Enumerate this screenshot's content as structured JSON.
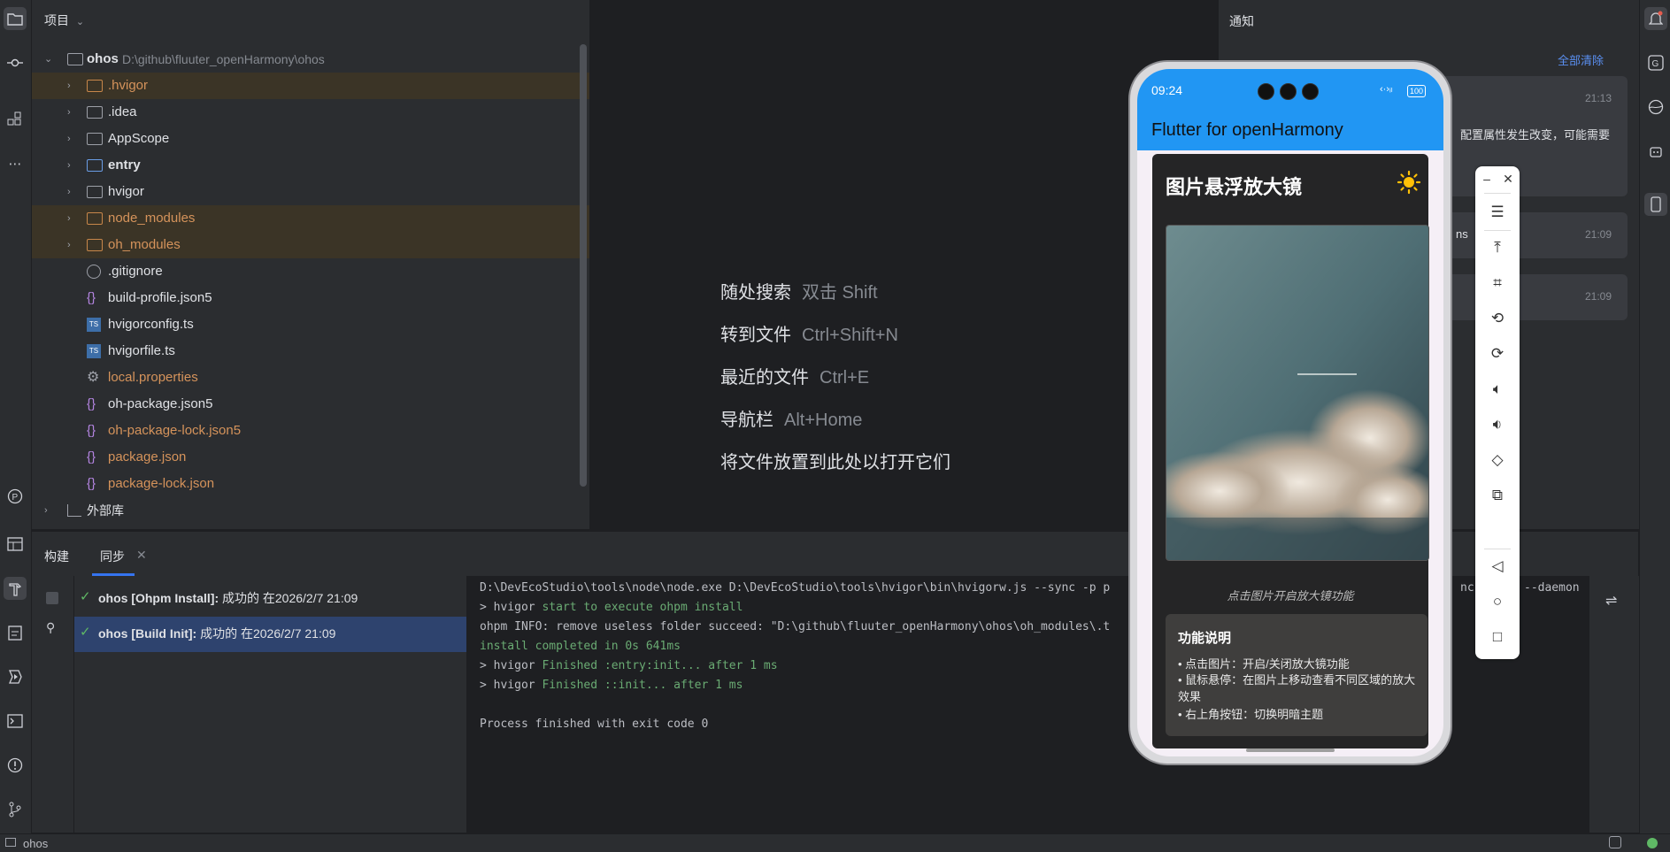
{
  "project": {
    "header": "项目",
    "root_name": "ohos",
    "root_path": "D:\\github\\fluuter_openHarmony\\ohos",
    "items": [
      {
        "label": ".hvigor",
        "kind": "folder",
        "excluded": true
      },
      {
        "label": ".idea",
        "kind": "folder",
        "excluded": false
      },
      {
        "label": "AppScope",
        "kind": "folder",
        "excluded": false
      },
      {
        "label": "entry",
        "kind": "module",
        "excluded": false
      },
      {
        "label": "hvigor",
        "kind": "folder",
        "excluded": false
      },
      {
        "label": "node_modules",
        "kind": "folder",
        "excluded": true
      },
      {
        "label": "oh_modules",
        "kind": "folder",
        "excluded": true
      },
      {
        "label": ".gitignore",
        "kind": "ignore"
      },
      {
        "label": "build-profile.json5",
        "kind": "json"
      },
      {
        "label": "hvigorconfig.ts",
        "kind": "ts"
      },
      {
        "label": "hvigorfile.ts",
        "kind": "ts"
      },
      {
        "label": "local.properties",
        "kind": "settings"
      },
      {
        "label": "oh-package.json5",
        "kind": "json"
      },
      {
        "label": "oh-package-lock.json5",
        "kind": "json"
      },
      {
        "label": "package.json",
        "kind": "json"
      },
      {
        "label": "package-lock.json",
        "kind": "json"
      }
    ],
    "external": "外部库"
  },
  "editor_hints": [
    {
      "text": "随处搜索",
      "key": "双击 Shift"
    },
    {
      "text": "转到文件",
      "key": "Ctrl+Shift+N"
    },
    {
      "text": "最近的文件",
      "key": "Ctrl+E"
    },
    {
      "text": "导航栏",
      "key": "Alt+Home"
    },
    {
      "text": "将文件放置到此处以打开它们",
      "key": ""
    }
  ],
  "notifications": {
    "title": "通知",
    "clear_all": "全部清除",
    "cards": [
      {
        "time": "21:13",
        "text": "配置属性发生改变，可能需要"
      },
      {
        "time": "21:09",
        "text": "ns"
      },
      {
        "time": "21:09",
        "text": ""
      }
    ]
  },
  "bottom": {
    "tab_build": "构建",
    "tab_sync": "同步",
    "builds": [
      {
        "title": "ohos [Ohpm Install]:",
        "status": " 成功的 在2026/2/7 21:09"
      },
      {
        "title": "ohos [Build Init]:",
        "status": " 成功的 在2026/2/7 21:09"
      }
    ],
    "console": [
      {
        "text": "D:\\DevEcoStudio\\tools\\node\\node.exe D:\\DevEcoStudio\\tools\\hvigor\\bin\\hvigorw.js --sync -p p",
        "tail": "ncre",
        "tail2": "--daemon"
      },
      {
        "pre": "> hvigor ",
        "green": "start to execute ohpm install"
      },
      {
        "text": "ohpm INFO: remove useless folder succeed: \"D:\\github\\fluuter_openHarmony\\ohos\\oh_modules\\.t"
      },
      {
        "green": "install completed in 0s 641ms"
      },
      {
        "pre": "> hvigor ",
        "green": "Finished :entry:init... after 1 ms"
      },
      {
        "pre": "> hvigor ",
        "green": "Finished ::init... after 1 ms"
      },
      {
        "text": ""
      },
      {
        "text": "Process finished with exit code 0"
      }
    ]
  },
  "status_bar": {
    "project": "ohos"
  },
  "phone": {
    "time": "09:24",
    "battery": "100",
    "app_title": "Flutter for openHarmony",
    "card_title": "图片悬浮放大镜",
    "caption": "点击图片开启放大镜功能",
    "info_title": "功能说明",
    "info_items": [
      "• 点击图片：开启/关闭放大镜功能",
      "• 鼠标悬停：在图片上移动查看不同区域的放大效果",
      "• 右上角按钮：切换明暗主题"
    ]
  },
  "colors": {
    "accent": "#2196f3",
    "ide_bg": "#1e1f22",
    "panel_bg": "#2b2d30",
    "success": "#5fb865"
  }
}
